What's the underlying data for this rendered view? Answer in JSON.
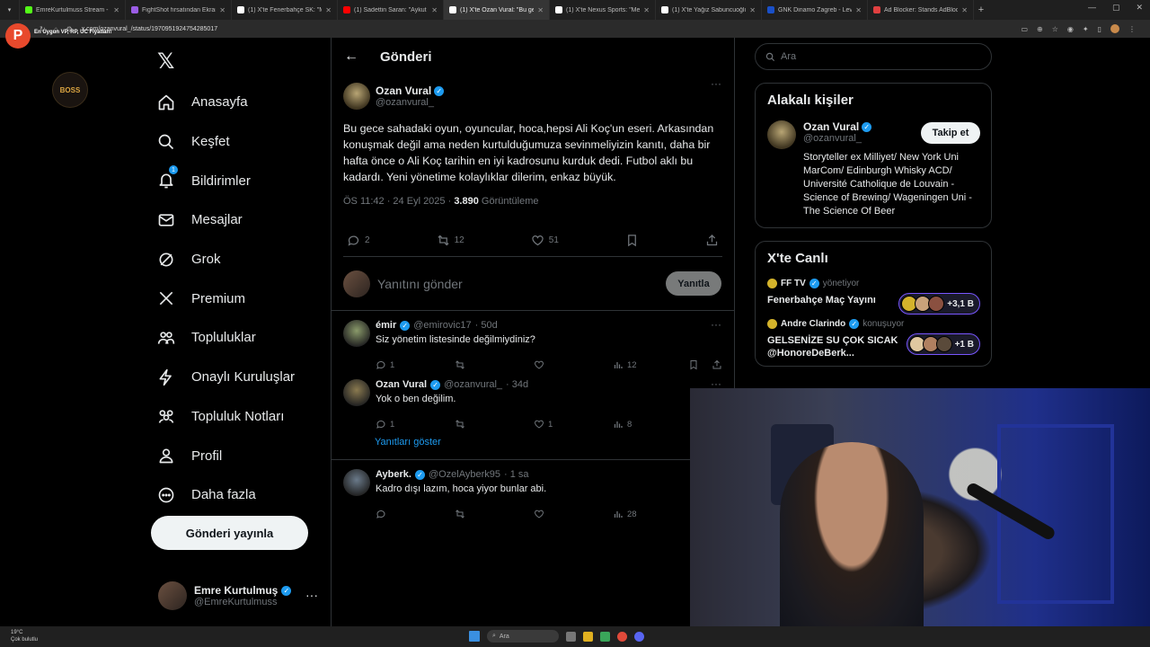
{
  "browser": {
    "tabs": [
      {
        "title": "EmreKurtulmuss Stream - Watch",
        "color": "#53fc18"
      },
      {
        "title": "FightShot fırsatından Ekram Güç",
        "color": "#9b5de5"
      },
      {
        "title": "(1) X'te Fenerbahçe SK: \"Maç s...",
        "color": "#ffffff"
      },
      {
        "title": "(1) Sadettin Saran: \"Aykut Ko...",
        "color": "#ff0000"
      },
      {
        "title": "(1) X'te Ozan Vural: \"Bu gece sa...",
        "color": "#ffffff"
      },
      {
        "title": "(1) X'te Nexus Sports: \"Mevlüt...",
        "color": "#ffffff"
      },
      {
        "title": "(1) X'te Yağız Sabuncuoğlu: \"Fe...",
        "color": "#ffffff"
      },
      {
        "title": "GNK Dinamo Zagreb - Levels...",
        "color": "#1a50c8"
      },
      {
        "title": "Ad Blocker: Stands AdBlocker - ...",
        "color": "#e04040"
      }
    ],
    "active_tab": 4,
    "url": "x.com/ozanvural_/status/1970951924754285017",
    "promo_text": "En Uygun VP, RP, UC Fiyatları!"
  },
  "nav": {
    "items": [
      {
        "label": "Anasayfa",
        "icon": "home-icon"
      },
      {
        "label": "Keşfet",
        "icon": "search-icon"
      },
      {
        "label": "Bildirimler",
        "icon": "bell-icon",
        "badge": "1"
      },
      {
        "label": "Mesajlar",
        "icon": "mail-icon"
      },
      {
        "label": "Grok",
        "icon": "grok-icon"
      },
      {
        "label": "Premium",
        "icon": "x-icon"
      },
      {
        "label": "Topluluklar",
        "icon": "communities-icon"
      },
      {
        "label": "Onaylı Kuruluşlar",
        "icon": "bolt-icon"
      },
      {
        "label": "Topluluk Notları",
        "icon": "notes-icon"
      },
      {
        "label": "Profil",
        "icon": "person-icon"
      },
      {
        "label": "Daha fazla",
        "icon": "more-circle-icon"
      }
    ],
    "post_button": "Gönderi yayınla",
    "user": {
      "name": "Emre Kurtulmuş",
      "handle": "@EmreKurtulmuss"
    },
    "boss_logo": "BOSS"
  },
  "main": {
    "header": "Gönderi",
    "tweet": {
      "name": "Ozan Vural",
      "handle": "@ozanvural_",
      "text": "Bu gece sahadaki oyun, oyuncular, hoca,hepsi Ali Koç'un eseri. Arkasından konuşmak değil ama neden kurtulduğumuza sevinmeliyizin kanıtı, daha bir hafta önce o Ali Koç tarihin en iyi kadrosunu kurduk dedi. Futbol aklı bu kadardı. Yeni yönetime kolaylıklar dilerim, enkaz büyük.",
      "time": "ÖS 11:42 · 24 Eyl 2025 · ",
      "views": "3.890",
      "views_label": " Görüntüleme",
      "replies": "2",
      "retweets": "12",
      "likes": "51"
    },
    "reply_placeholder": "Yanıtını gönder",
    "reply_button": "Yanıtla",
    "replies": [
      {
        "name": "émir",
        "handle": "@emirovic17",
        "age": "· 50d",
        "text": "Siz yönetim listesinde değilmiydiniz?",
        "r": "1",
        "rt": "",
        "l": "",
        "v": "12",
        "avatar": "#8a9a6a"
      },
      {
        "name": "Ozan Vural",
        "handle": "@ozanvural_",
        "age": "· 34d",
        "text": "Yok o ben değilim.",
        "r": "1",
        "rt": "",
        "l": "1",
        "v": "8",
        "avatar": "#8a7a50"
      },
      {
        "name": "Ayberk.",
        "handle": "@OzelAyberk95",
        "age": "· 1 sa",
        "text": "Kadro dışı lazım, hoca yiyor bunlar abi.",
        "r": "",
        "rt": "",
        "l": "",
        "v": "28",
        "avatar": "#6a7a8a"
      }
    ],
    "show_replies": "Yanıtları göster"
  },
  "side": {
    "search_placeholder": "Ara",
    "related_title": "Alakalı kişiler",
    "related": {
      "name": "Ozan Vural",
      "handle": "@ozanvural_",
      "follow": "Takip et",
      "bio": "Storyteller ex Milliyet/ New York Uni MarCom/ Edinburgh Whisky ACD/ Université Catholique de Louvain - Science of Brewing/ Wageningen Uni - The Science Of Beer"
    },
    "live_title": "X'te Canlı",
    "live": [
      {
        "host": "FF TV",
        "role": "yönetiyor",
        "title": "Fenerbahçe Maç Yayını",
        "count": "+3,1 B"
      },
      {
        "host": "Andre Clarindo",
        "role": "konuşuyor",
        "title": "GELSENİZE SU ÇOK SICAK @HonoreDeBerk...",
        "count": "+1 B"
      }
    ]
  },
  "taskbar": {
    "weather_temp": "19°C",
    "weather_desc": "Çok bulutlu",
    "search": "Ara"
  }
}
